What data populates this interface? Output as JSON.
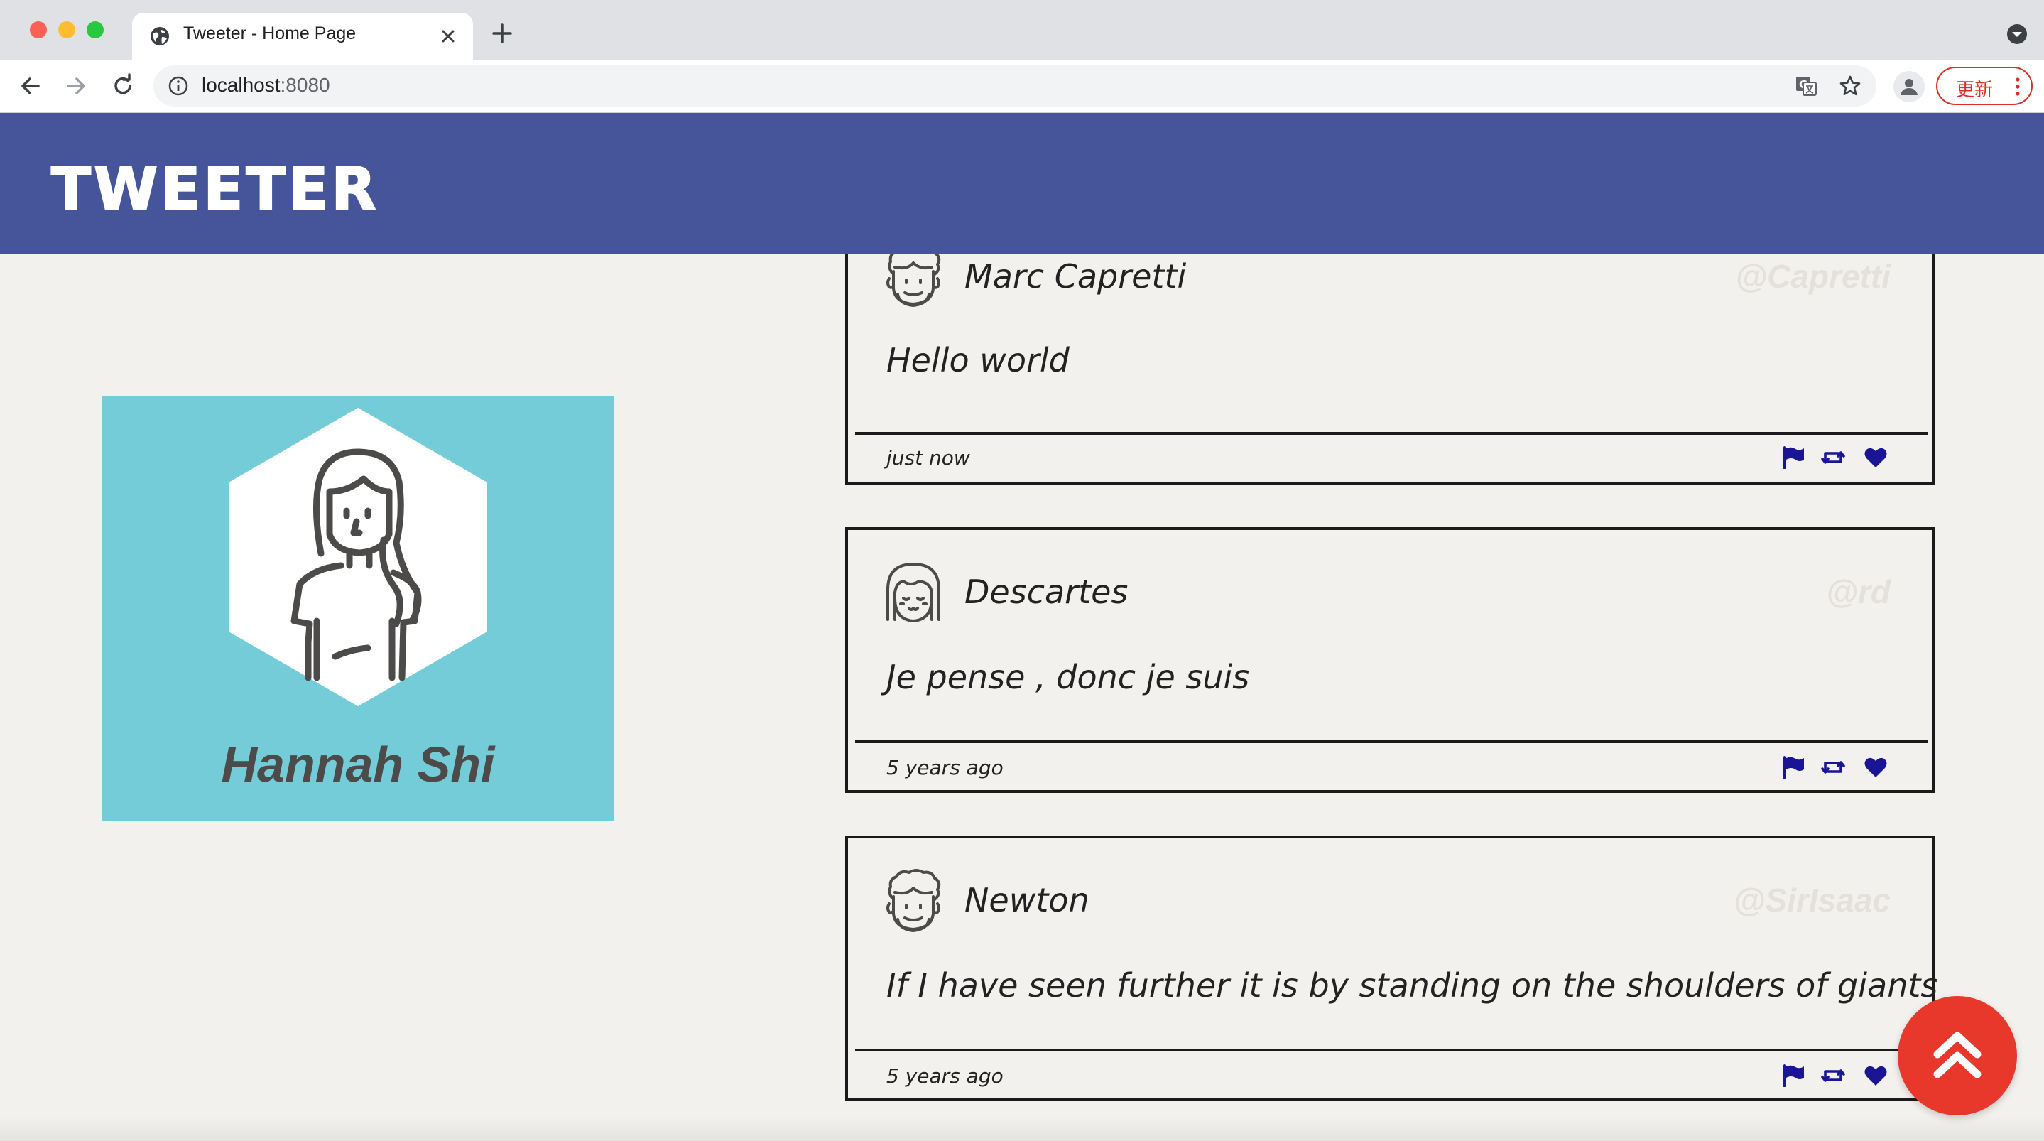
{
  "browser": {
    "tab_title": "Tweeter - Home Page",
    "url_host": "localhost",
    "url_port": ":8080",
    "update_label": "更新"
  },
  "app": {
    "logo": "TWEETER",
    "header_color": "#46559a"
  },
  "profile": {
    "name": "Hannah Shi",
    "card_color": "#75ccd9"
  },
  "tweets": [
    {
      "name": "Marc Capretti",
      "handle": "@Capretti",
      "content": "Hello world",
      "time": "just now",
      "avatar_icon": "man-curly-hair-icon"
    },
    {
      "name": "Descartes",
      "handle": "@rd",
      "content": "Je pense , donc je suis",
      "time": "5 years ago",
      "avatar_icon": "woman-bangs-icon"
    },
    {
      "name": "Newton",
      "handle": "@SirIsaac",
      "content": "If I have seen further it is by standing on the shoulders of giants",
      "time": "5 years ago",
      "avatar_icon": "man-curly-hair-icon"
    }
  ],
  "action_icon_color": "#1a1594",
  "scroll_top_color": "#e8372b"
}
